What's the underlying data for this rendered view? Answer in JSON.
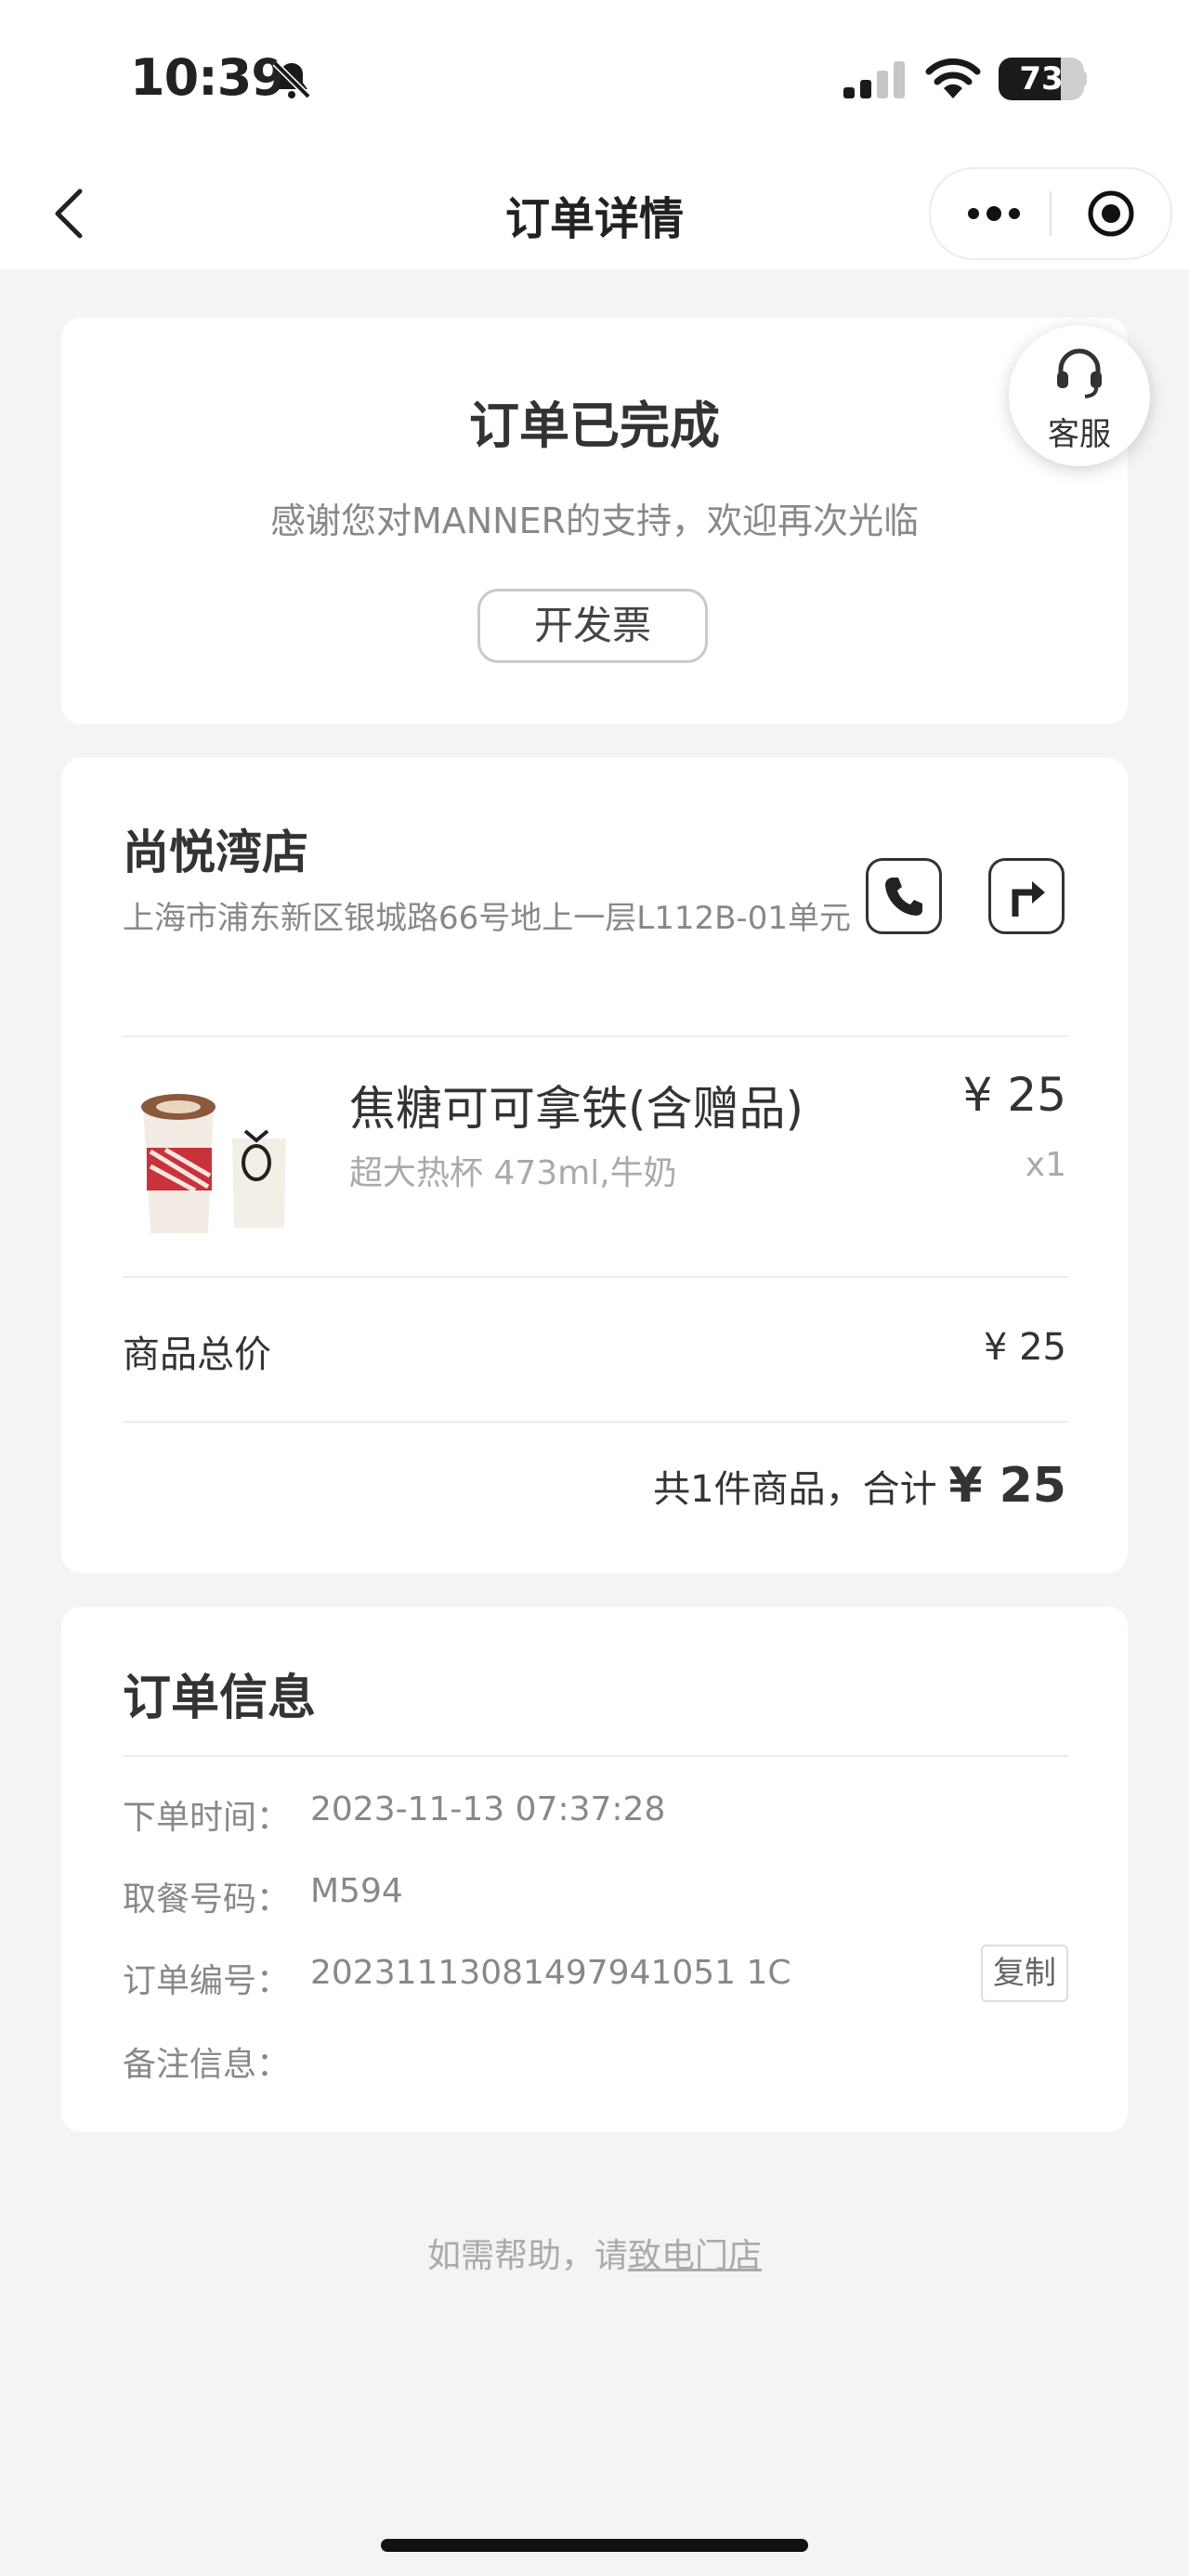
{
  "status_bar": {
    "time": "10:39",
    "battery": "73",
    "battery_level": 0.73
  },
  "nav": {
    "title": "订单详情"
  },
  "status_card": {
    "title": "订单已完成",
    "subtitle": "感谢您对MANNER的支持，欢迎再次光临",
    "invoice_button": "开发票"
  },
  "customer_service": {
    "label": "客服"
  },
  "store": {
    "name": "尚悦湾店",
    "address": "上海市浦东新区银城路66号地上一层L112B-01单元"
  },
  "product": {
    "name": "焦糖可可拿铁(含赠品)",
    "spec": "超大热杯 473ml,牛奶",
    "price": "¥ 25",
    "qty": "x1"
  },
  "totals": {
    "goods_total_label": "商品总价",
    "goods_total_value": "¥ 25",
    "summary_prefix": "共1件商品，合计",
    "summary_total": "¥ 25"
  },
  "order_info": {
    "title": "订单信息",
    "rows": [
      {
        "label": "下单时间：",
        "value": "2023-11-13 07:37:28"
      },
      {
        "label": "取餐号码：",
        "value": "M594"
      },
      {
        "label": "订单编号：",
        "value": "20231113081497941051 1C"
      },
      {
        "label": "备注信息：",
        "value": ""
      }
    ],
    "copy_button": "复制"
  },
  "help": {
    "prefix": "如需帮助，请",
    "link": "致电门店"
  },
  "icons": {
    "bell": "bell-slash-icon",
    "back": "chevron-left-icon",
    "more": "more-dots-icon",
    "target": "target-circle-icon",
    "headset": "headset-icon",
    "phone": "phone-icon",
    "route": "route-arrow-icon"
  }
}
